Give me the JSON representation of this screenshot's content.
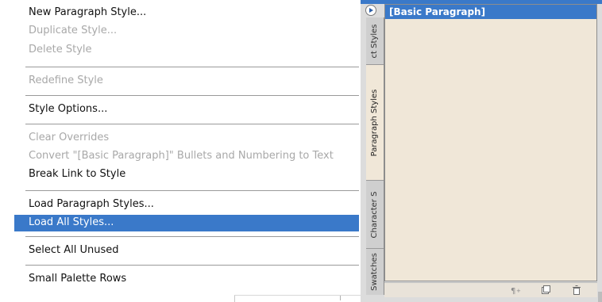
{
  "menu": {
    "items": [
      {
        "label": "New Paragraph Style...",
        "enabled": true
      },
      {
        "label": "Duplicate Style...",
        "enabled": false
      },
      {
        "label": "Delete Style",
        "enabled": false
      },
      {
        "label": "Redefine Style",
        "enabled": false
      },
      {
        "label": "Style Options...",
        "enabled": true
      },
      {
        "label": "Clear Overrides",
        "enabled": false
      },
      {
        "label": "Convert \"[Basic Paragraph]\" Bullets and Numbering to Text",
        "enabled": false
      },
      {
        "label": "Break Link to Style",
        "enabled": true
      },
      {
        "label": "Load Paragraph Styles...",
        "enabled": true
      },
      {
        "label": "Load All Styles...",
        "enabled": true,
        "highlighted": true
      },
      {
        "label": "Select All Unused",
        "enabled": true
      },
      {
        "label": "Small Palette Rows",
        "enabled": true
      }
    ]
  },
  "panel": {
    "tabs": [
      {
        "label": "Swatches"
      },
      {
        "label": "Character S"
      },
      {
        "label": "Paragraph Styles",
        "active": true
      },
      {
        "label": "ct Styles"
      }
    ],
    "styles": [
      {
        "label": "[Basic Paragraph]",
        "selected": true
      }
    ],
    "footer_icons": [
      "clear-overrides-icon",
      "new-style-icon",
      "delete-style-icon"
    ]
  },
  "colors": {
    "highlight": "#3a79c9",
    "panel_bg": "#f0e7d8",
    "disabled_text": "#a8a8a8"
  }
}
